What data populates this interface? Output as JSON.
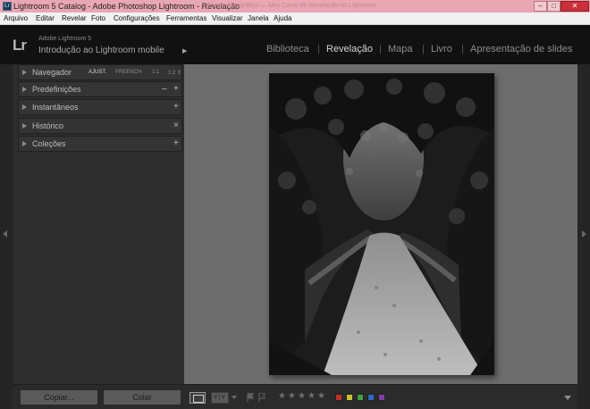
{
  "window": {
    "title": "Lightroom 5 Catalog - Adobe Photoshop Lightroom - Revelação",
    "ghost_text": "Fórum Fotográfico — Mini Curso de Revelação no Lightroom",
    "icon_text": "Lr",
    "minimize_label": "‒",
    "maximize_label": "□",
    "close_label": "✕"
  },
  "menu": {
    "items": [
      "Arquivo",
      "Editar",
      "Revelar",
      "Foto",
      "Configurações",
      "Ferramentas",
      "Visualizar",
      "Janela",
      "Ajuda"
    ]
  },
  "identity": {
    "logo": "Lr",
    "product": "Adobe Lightroom 5",
    "headline": "Introdução ao Lightroom mobile",
    "arrow": "▶"
  },
  "modules": {
    "items": [
      "Biblioteca",
      "Revelação",
      "Mapa",
      "Livro",
      "Apresentação de slides"
    ],
    "active": "Revelação",
    "separator": "|"
  },
  "left_panel": {
    "navigator": {
      "label": "Navegador",
      "options": [
        "AJUST.",
        "PREENCH",
        "1:1",
        "1:2 ⇕"
      ],
      "active_option": "AJUST."
    },
    "presets": {
      "label": "Predefinições",
      "minus": "–",
      "plus": "+"
    },
    "snapshots": {
      "label": "Instantâneos",
      "plus": "+"
    },
    "history": {
      "label": "Histórico",
      "close": "×"
    },
    "collections": {
      "label": "Coleções",
      "plus": "+"
    },
    "copy_button": "Copiar...",
    "paste_button": "Colar"
  },
  "toolbar": {
    "view_compare": "Y|Y",
    "stars": [
      "★",
      "★",
      "★",
      "★",
      "★"
    ],
    "rating": 0,
    "color_labels": [
      "#c0302e",
      "#c9c033",
      "#3fa23c",
      "#3168c2",
      "#7c3fa5"
    ]
  },
  "colors": {
    "accent_active": "#d4d4d4",
    "panel_bg": "#2d2d2d",
    "canvas_bg": "#6d6d6d",
    "titlebar_bg": "#e9a6b3"
  }
}
